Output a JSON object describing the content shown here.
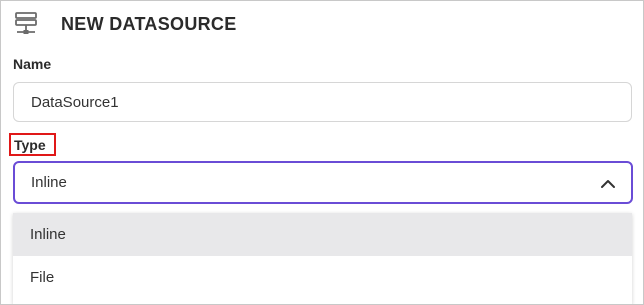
{
  "header": {
    "title": "NEW DATASOURCE",
    "icon": "datasource-server-icon"
  },
  "form": {
    "name_label": "Name",
    "name_value": "DataSource1",
    "type_label": "Type",
    "type_value": "Inline",
    "type_options": [
      "Inline",
      "File"
    ],
    "highlight_color": "#e01818",
    "focus_color": "#6a4cd6"
  }
}
